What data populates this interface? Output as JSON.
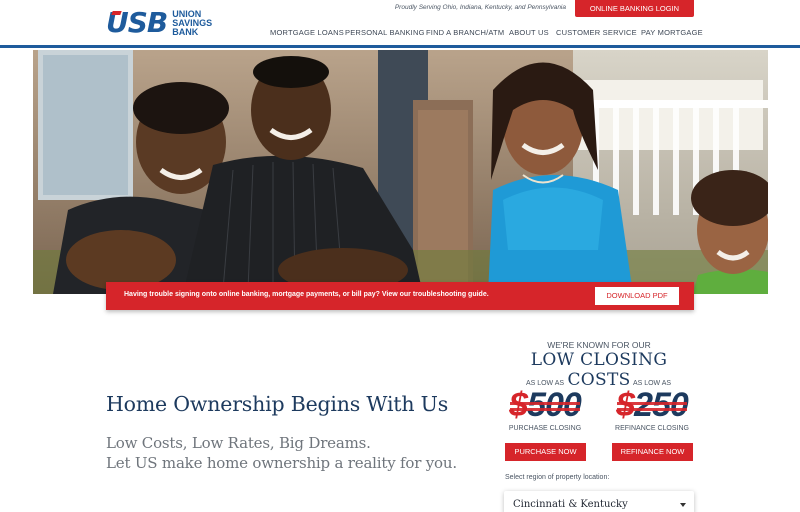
{
  "brand": {
    "logo_mark": "USB",
    "logo_text": [
      "UNION",
      "SAVINGS",
      "BANK"
    ],
    "primary_color": "#1e5b9c",
    "accent_color": "#d6252a"
  },
  "header": {
    "tagline": "Proudly Serving Ohio, Indiana, Kentucky, and Pennsylvania",
    "login_button": "ONLINE BANKING LOGIN"
  },
  "nav": {
    "items": [
      {
        "label": "MORTGAGE LOANS"
      },
      {
        "label": "PERSONAL BANKING"
      },
      {
        "label": "FIND A BRANCH/ATM"
      },
      {
        "label": "ABOUT US"
      },
      {
        "label": "CUSTOMER SERVICE"
      },
      {
        "label": "PAY MORTGAGE"
      }
    ]
  },
  "alert": {
    "text": "Having trouble signing onto online banking, mortgage payments, or bill pay? View our troubleshooting guide.",
    "button": "DOWNLOAD PDF"
  },
  "main": {
    "headline": "Home Ownership Begins With Us",
    "sublines": [
      "Low Costs, Low Rates, Big Dreams.",
      "Let US make home ownership a reality for you."
    ]
  },
  "closing_costs": {
    "kicker": "WE'RE KNOWN FOR OUR",
    "title": "LOW CLOSING COSTS",
    "offers": [
      {
        "as_low_as": "AS LOW AS",
        "currency": "$",
        "amount": "500",
        "label": "PURCHASE CLOSING",
        "button": "PURCHASE NOW"
      },
      {
        "as_low_as": "AS LOW AS",
        "currency": "$",
        "amount": "250",
        "label": "REFINANCE CLOSING",
        "button": "REFINANCE NOW"
      }
    ]
  },
  "region": {
    "label": "Select region of property location:",
    "selected": "Cincinnati & Kentucky"
  },
  "icons": {
    "dropdown": "chevron-down-icon"
  }
}
